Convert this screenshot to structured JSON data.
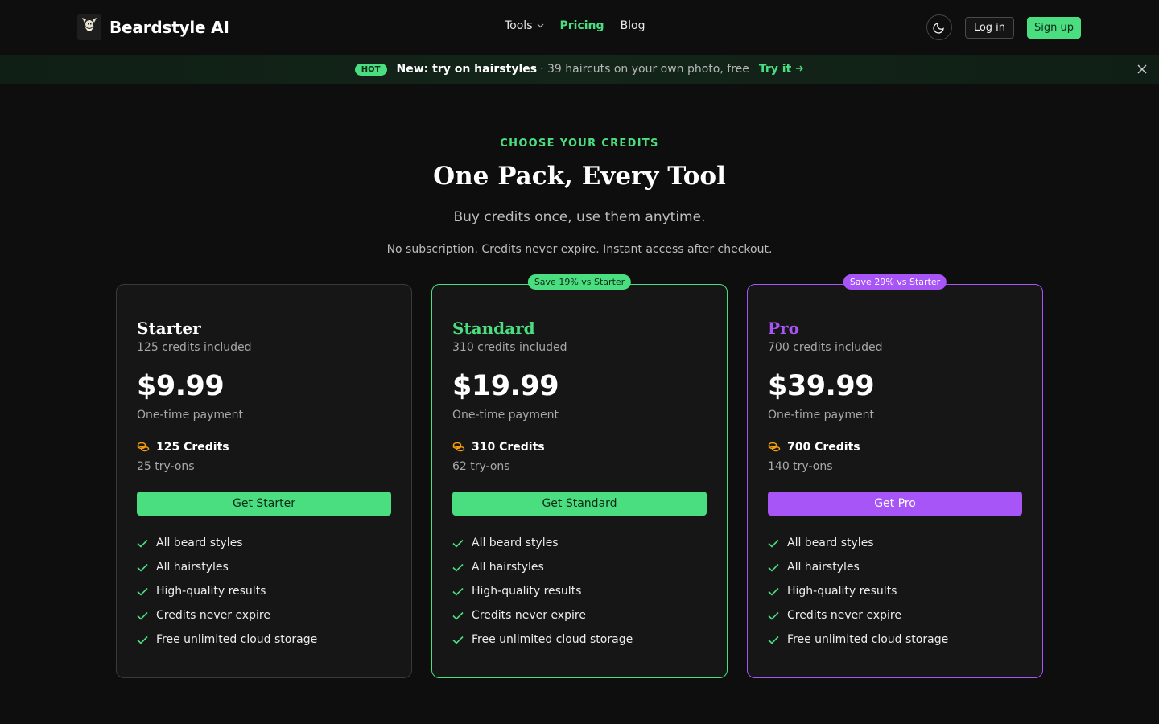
{
  "brand": {
    "name": "Beardstyle AI",
    "logo_icon": "bearded-man-logo-icon"
  },
  "nav": {
    "tools": "Tools",
    "pricing": "Pricing",
    "blog": "Blog"
  },
  "header_actions": {
    "login": "Log in",
    "signup": "Sign up",
    "theme_icon": "moon-icon"
  },
  "banner": {
    "badge": "HOT",
    "title": "New: try on hairstyles",
    "subtitle": "· 39 haircuts on your own photo, free",
    "cta": "Try it",
    "cta_icon": "arrow-right-icon",
    "close_icon": "close-icon"
  },
  "hero": {
    "eyebrow": "CHOOSE YOUR CREDITS",
    "title": "One Pack, Every Tool",
    "subtitle": "Buy credits once, use them anytime.",
    "note": "No subscription. Credits never expire. Instant access after checkout."
  },
  "colors": {
    "accent_green": "#4ade80",
    "accent_purple": "#a855f7",
    "background": "#0e0e0e",
    "card_background": "#161616",
    "coin_orange": "#f59e0b"
  },
  "plans": [
    {
      "name": "Starter",
      "credits_included": "125 credits included",
      "price": "$9.99",
      "payment": "One-time payment",
      "credits": "125 Credits",
      "tryons": "25 try-ons",
      "cta": "Get Starter",
      "badge": "",
      "features": [
        "All beard styles",
        "All hairstyles",
        "High-quality results",
        "Credits never expire",
        "Free unlimited cloud storage"
      ]
    },
    {
      "name": "Standard",
      "credits_included": "310 credits included",
      "price": "$19.99",
      "payment": "One-time payment",
      "credits": "310 Credits",
      "tryons": "62 try-ons",
      "cta": "Get Standard",
      "badge": "Save 19% vs Starter",
      "features": [
        "All beard styles",
        "All hairstyles",
        "High-quality results",
        "Credits never expire",
        "Free unlimited cloud storage"
      ]
    },
    {
      "name": "Pro",
      "credits_included": "700 credits included",
      "price": "$39.99",
      "payment": "One-time payment",
      "credits": "700 Credits",
      "tryons": "140 try-ons",
      "cta": "Get Pro",
      "badge": "Save 29% vs Starter",
      "features": [
        "All beard styles",
        "All hairstyles",
        "High-quality results",
        "Credits never expire",
        "Free unlimited cloud storage"
      ]
    }
  ]
}
